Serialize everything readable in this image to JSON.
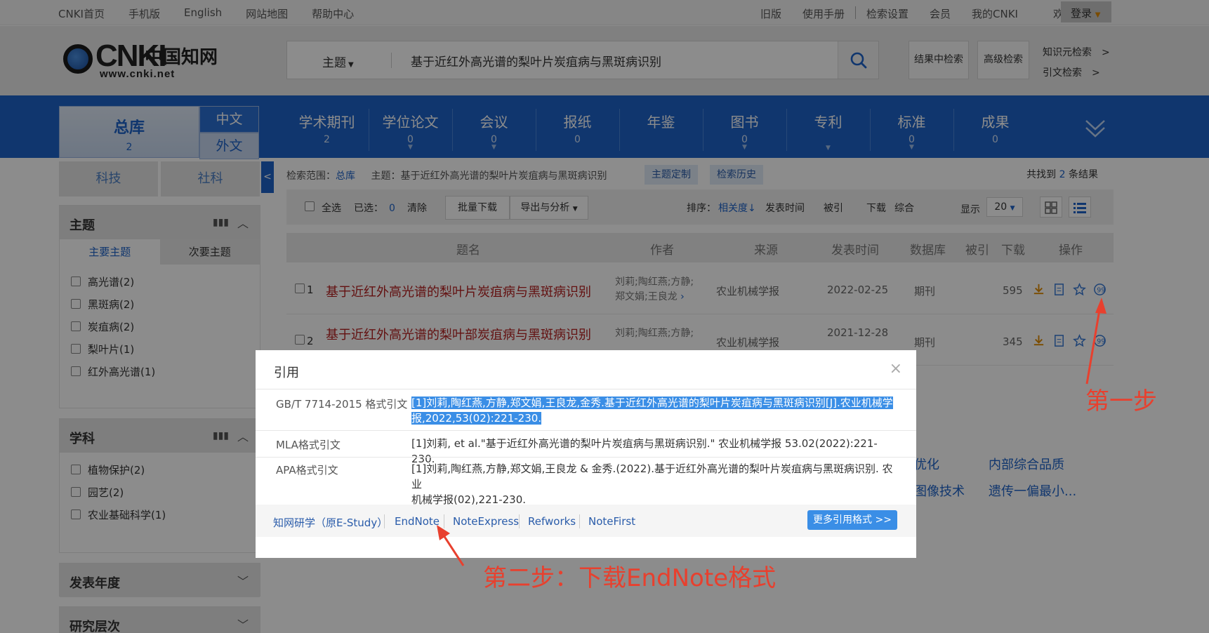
{
  "topbar": {
    "left": [
      "CNKI首页",
      "手机版",
      "English",
      "网站地图",
      "帮助中心"
    ],
    "right": [
      "旧版",
      "使用手册",
      "检索设置",
      "会员",
      "我的CNKI",
      "欢迎"
    ],
    "login": "登录"
  },
  "logo": {
    "letters": "CNKI",
    "cn": "中国知网",
    "url": "www.cnki.net"
  },
  "search": {
    "field": "主题",
    "query": "基于近红外高光谱的梨叶片炭疽病与黑斑病识别",
    "in_results": "结果中检索",
    "advanced": "高级检索",
    "kb_search": "知识元检索",
    "cite_search": "引文检索",
    "arrow": ">"
  },
  "nav": {
    "zongku": {
      "label": "总库",
      "count": "2"
    },
    "zh": "中文",
    "wai": "外文",
    "items": [
      {
        "label": "学术期刊",
        "count": "2"
      },
      {
        "label": "学位论文",
        "count": "0"
      },
      {
        "label": "会议",
        "count": "0"
      },
      {
        "label": "报纸",
        "count": "0"
      },
      {
        "label": "年鉴",
        "count": ""
      },
      {
        "label": "图书",
        "count": "0"
      },
      {
        "label": "专利",
        "count": ""
      },
      {
        "label": "标准",
        "count": "0"
      },
      {
        "label": "成果",
        "count": "0"
      }
    ]
  },
  "sidebar": {
    "tabs": [
      "科技",
      "社科"
    ],
    "topic": {
      "title": "主题",
      "subtabs": [
        "主要主题",
        "次要主题"
      ],
      "items": [
        "高光谱(2)",
        "黑斑病(2)",
        "炭疽病(2)",
        "梨叶片(1)",
        "红外高光谱(1)"
      ]
    },
    "subject": {
      "title": "学科",
      "items": [
        "植物保护(2)",
        "园艺(2)",
        "农业基础科学(1)"
      ]
    },
    "year_title": "发表年度",
    "level_title": "研究层次"
  },
  "main": {
    "scope_label": "检索范围：",
    "scope_value": "总库",
    "scope_query": "主题：基于近红外高光谱的梨叶片炭疽病与黑斑病识别",
    "chip_custom": "主题定制",
    "chip_history": "检索历史",
    "total_pre": "共找到",
    "total_num": "2",
    "total_post": "条结果",
    "toolbar": {
      "select_all": "全选",
      "selected": "已选：",
      "selected_num": "0",
      "clear": "清除",
      "batch": "批量下载",
      "export": "导出与分析",
      "sort": "排序：",
      "sort_rel": "相关度",
      "sort_time": "发表时间",
      "sort_cite": "被引",
      "sort_dl": "下载",
      "sort_all": "综合",
      "show": "显示",
      "show_num": "20"
    },
    "headers": [
      "题名",
      "作者",
      "来源",
      "发表时间",
      "数据库",
      "被引",
      "下载",
      "操作"
    ],
    "rows": [
      {
        "idx": "1",
        "title": "基于近红外高光谱的梨叶片炭疽病与黑斑病识别",
        "authors1": "刘莉;陶红燕;方静;",
        "authors2": "郑文娟;王良龙",
        "source": "农业机械学报",
        "date": "2022-02-25",
        "db": "期刊",
        "downloads": "595"
      },
      {
        "idx": "2",
        "title": "基于近红外高光谱的梨叶部炭疽病与黑斑病识别",
        "authors1": "刘莉;陶红燕;方静;",
        "authors2": "",
        "source": "农业机械学报",
        "date": "2021-12-28",
        "db": "期刊",
        "downloads": "345"
      }
    ],
    "bg_links": [
      "优化",
      "内部综合品质",
      "图像技术",
      "遗传一偏最小..."
    ]
  },
  "dialog": {
    "title": "引用",
    "rows": [
      {
        "label": "GB/T 7714-2015 格式引文",
        "line1": "[1]刘莉,陶红燕,方静,郑文娟,王良龙,金秀.基于近红外高光谱的梨叶片炭疽病与黑斑病识别[J].农业机械学",
        "line2": "报,2022,53(02):221-230."
      },
      {
        "label": "MLA格式引文",
        "line1": "[1]刘莉, et al.\"基于近红外高光谱的梨叶片炭疽病与黑斑病识别.\" 农业机械学报 53.02(2022):221-230.",
        "line2": ""
      },
      {
        "label": "APA格式引文",
        "line1": "[1]刘莉,陶红燕,方静,郑文娟,王良龙 & 金秀.(2022).基于近红外高光谱的梨叶片炭疽病与黑斑病识别. 农业",
        "line2": "机械学报(02),221-230."
      }
    ],
    "links": [
      "知网研学（原E-Study）",
      "EndNote",
      "NoteExpress",
      "Refworks",
      "NoteFirst"
    ],
    "more": "更多引用格式 >>"
  },
  "annotations": {
    "step1": "第一步",
    "step2": "第二步：下载EndNote格式"
  },
  "colors": {
    "nav": "#1e63c9",
    "title_red": "#b52020",
    "annot": "#e8402e",
    "highlight": "#3a8ee6"
  }
}
